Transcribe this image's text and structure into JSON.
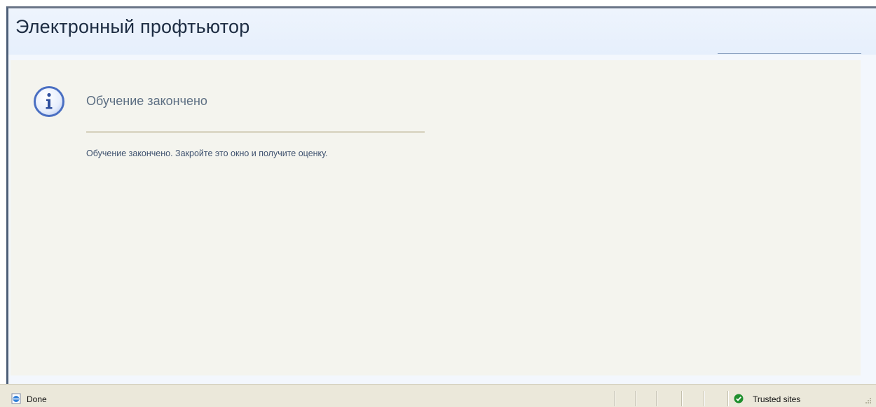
{
  "app": {
    "title": "Электронный профтьютор"
  },
  "message": {
    "icon": "info-icon",
    "title": "Обучение закончено",
    "body": "Обучение закончено. Закройте это окно и получите оценку."
  },
  "statusbar": {
    "status_icon": "ie-page-icon",
    "status_text": "Done",
    "zone_icon": "check-shield-icon",
    "zone_text": "Trusted sites"
  },
  "colors": {
    "header_bg": "#eef4fd",
    "content_bg": "#f4f4ee",
    "title_text": "#1e2d43",
    "message_text": "#5d6f83",
    "statusbar_bg": "#ebe8da",
    "zone_green": "#1f8f2e"
  }
}
